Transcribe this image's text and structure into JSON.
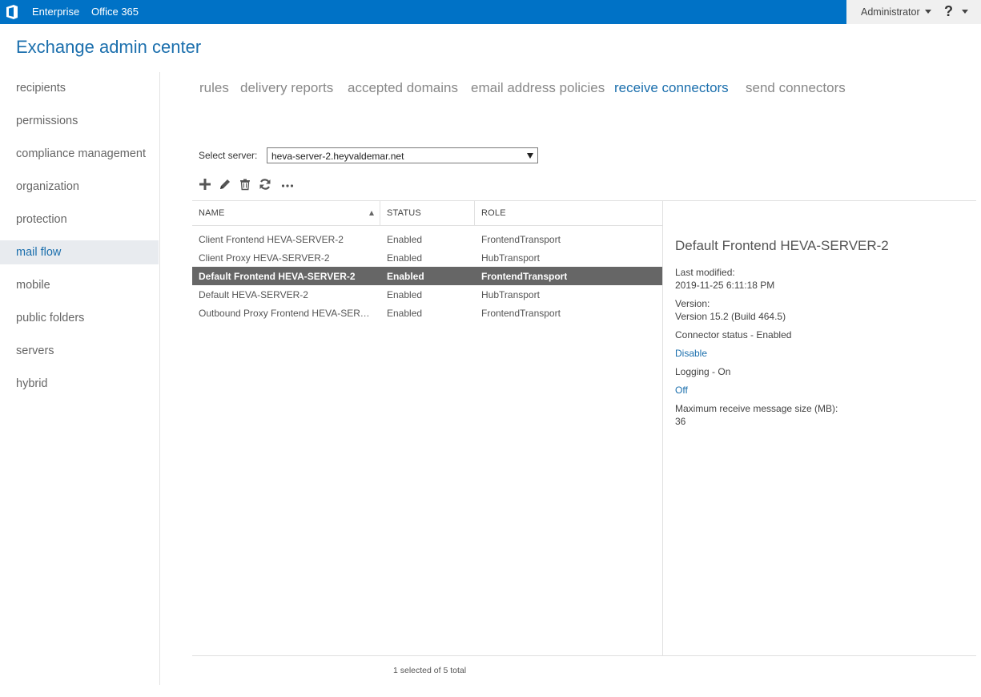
{
  "colors": {
    "topbar": "#0072c6",
    "accent": "#1b6fad",
    "selected_row": "#666666",
    "nav_active_bg": "#e8ebef"
  },
  "topbar": {
    "logo_icon": "office-logo-icon",
    "links": [
      "Enterprise",
      "Office 365"
    ],
    "user": "Administrator",
    "help_label": "?"
  },
  "header": {
    "title": "Exchange admin center"
  },
  "sidebar": {
    "items": [
      {
        "label": "recipients"
      },
      {
        "label": "permissions"
      },
      {
        "label": "compliance management"
      },
      {
        "label": "organization"
      },
      {
        "label": "protection"
      },
      {
        "label": "mail flow",
        "active": true
      },
      {
        "label": "mobile"
      },
      {
        "label": "public folders"
      },
      {
        "label": "servers"
      },
      {
        "label": "hybrid"
      }
    ]
  },
  "tabs": [
    {
      "label": "rules"
    },
    {
      "label": "delivery reports"
    },
    {
      "label": "accepted domains"
    },
    {
      "label": "email address policies"
    },
    {
      "label": "receive connectors",
      "active": true
    },
    {
      "label": "send connectors"
    }
  ],
  "server_select": {
    "label": "Select server:",
    "value": "heva-server-2.heyvaldemar.net"
  },
  "toolbar": {
    "icons": [
      "add-icon",
      "edit-icon",
      "delete-icon",
      "refresh-icon",
      "more-icon"
    ]
  },
  "table": {
    "columns": [
      "NAME",
      "STATUS",
      "ROLE"
    ],
    "sort": "NAME ascending",
    "rows": [
      {
        "name": "Client Frontend HEVA-SERVER-2",
        "status": "Enabled",
        "role": "FrontendTransport"
      },
      {
        "name": "Client Proxy HEVA-SERVER-2",
        "status": "Enabled",
        "role": "HubTransport"
      },
      {
        "name": "Default Frontend HEVA-SERVER-2",
        "status": "Enabled",
        "role": "FrontendTransport",
        "selected": true
      },
      {
        "name": "Default HEVA-SERVER-2",
        "status": "Enabled",
        "role": "HubTransport"
      },
      {
        "name": "Outbound Proxy Frontend HEVA-SERVE...",
        "status": "Enabled",
        "role": "FrontendTransport"
      }
    ],
    "footer": "1 selected of 5 total"
  },
  "details": {
    "title": "Default Frontend HEVA-SERVER-2",
    "last_modified_label": "Last modified:",
    "last_modified_value": "2019-11-25 6:11:18 PM",
    "version_label": "Version:",
    "version_value": "Version 15.2 (Build 464.5)",
    "connector_status": "Connector status - Enabled",
    "disable_link": "Disable",
    "logging": "Logging - On",
    "logging_off_link": "Off",
    "max_size_label": "Maximum receive message size (MB):",
    "max_size_value": "36"
  }
}
